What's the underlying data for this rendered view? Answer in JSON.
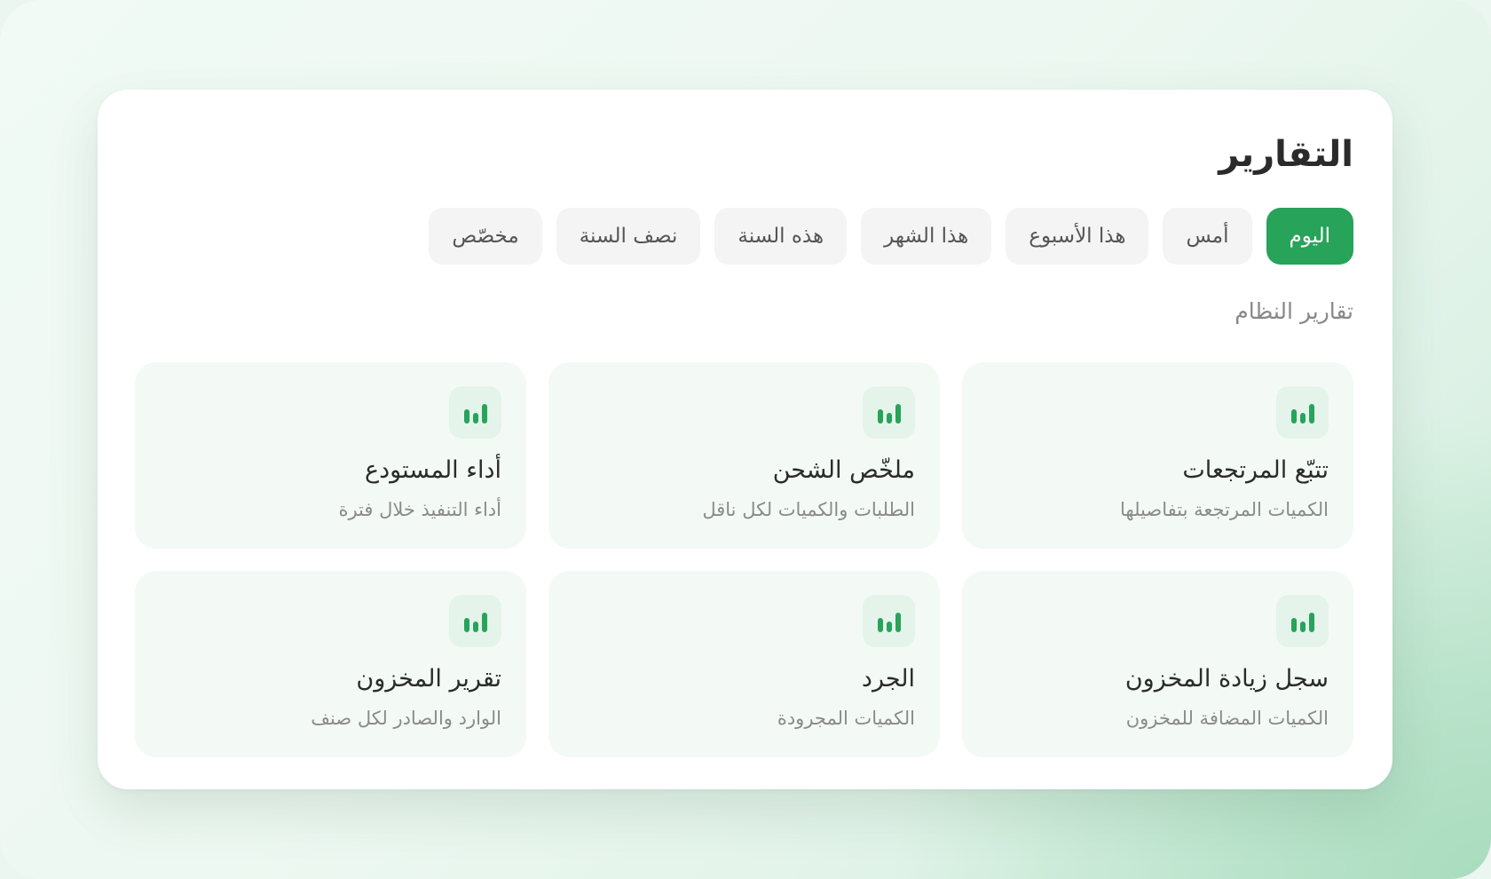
{
  "header": {
    "title": "التقارير"
  },
  "periods": [
    {
      "label": "اليوم",
      "active": true
    },
    {
      "label": "أمس",
      "active": false
    },
    {
      "label": "هذا الأسبوع",
      "active": false
    },
    {
      "label": "هذا الشهر",
      "active": false
    },
    {
      "label": "هذه السنة",
      "active": false
    },
    {
      "label": "نصف السنة",
      "active": false
    },
    {
      "label": "مخصّص",
      "active": false
    }
  ],
  "section": {
    "label": "تقارير النظام"
  },
  "reports": [
    {
      "title": "تتبّع المرتجعات",
      "description": "الكميات المرتجعة بتفاصيلها",
      "icon": "bar-chart-icon"
    },
    {
      "title": "ملخّص الشحن",
      "description": "الطلبات والكميات لكل ناقل",
      "icon": "bar-chart-icon"
    },
    {
      "title": "أداء المستودع",
      "description": "أداء التنفيذ خلال فترة",
      "icon": "bar-chart-icon"
    },
    {
      "title": "سجل زيادة المخزون",
      "description": "الكميات المضافة للمخزون",
      "icon": "bar-chart-icon"
    },
    {
      "title": "الجرد",
      "description": "الكميات المجرودة",
      "icon": "bar-chart-icon"
    },
    {
      "title": "تقرير المخزون",
      "description": "الوارد والصادر لكل صنف",
      "icon": "bar-chart-icon"
    }
  ],
  "colors": {
    "accent": "#27a35a",
    "icon_bg": "#e4f4ea",
    "card_bg": "#f3faf6",
    "chip_bg": "#f4f4f4"
  }
}
